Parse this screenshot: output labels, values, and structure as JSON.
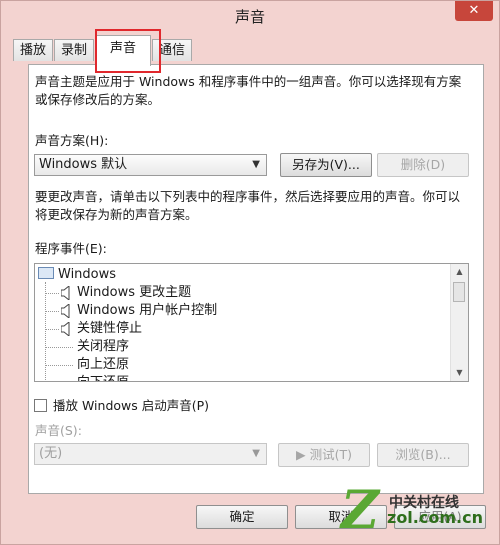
{
  "window": {
    "title": "声音",
    "close_symbol": "✕"
  },
  "tabs": [
    {
      "label": "播放",
      "active": false
    },
    {
      "label": "录制",
      "active": false
    },
    {
      "label": "声音",
      "active": true
    },
    {
      "label": "通信",
      "active": false
    }
  ],
  "intro": {
    "line1": "声音主题是应用于 Windows 和程序事件中的一组声音。你可以选择现有方案",
    "line2": "或保存修改后的方案。"
  },
  "scheme": {
    "label": "声音方案(H):",
    "selected": "Windows 默认",
    "save_as_label": "另存为(V)...",
    "delete_label": "删除(D)"
  },
  "instructions": {
    "line1": "要更改声音，请单击以下列表中的程序事件，然后选择要应用的声音。你可以",
    "line2": "将更改保存为新的声音方案。"
  },
  "events": {
    "label": "程序事件(E):",
    "group": "Windows",
    "items": [
      {
        "label": "Windows 更改主题",
        "has_sound": true
      },
      {
        "label": "Windows 用户帐户控制",
        "has_sound": true
      },
      {
        "label": "关键性停止",
        "has_sound": true
      },
      {
        "label": "关闭程序",
        "has_sound": false
      },
      {
        "label": "向上还原",
        "has_sound": false
      },
      {
        "label": "向下还原",
        "has_sound": false
      }
    ]
  },
  "startup": {
    "label": "播放 Windows 启动声音(P)",
    "checked": false
  },
  "sound": {
    "label": "声音(S):",
    "selected": "(无)",
    "test_label": "▶ 测试(T)",
    "browse_label": "浏览(B)..."
  },
  "footer": {
    "ok_label": "确定",
    "cancel_label": "取消",
    "apply_label": "应用(A)"
  },
  "watermark": {
    "logo_letter": "Z",
    "cn": "中关村在线",
    "url": "zol.com.cn"
  },
  "colors": {
    "highlight": "#e0282d",
    "close": "#c7463b",
    "brand_green": "#5aa834"
  }
}
